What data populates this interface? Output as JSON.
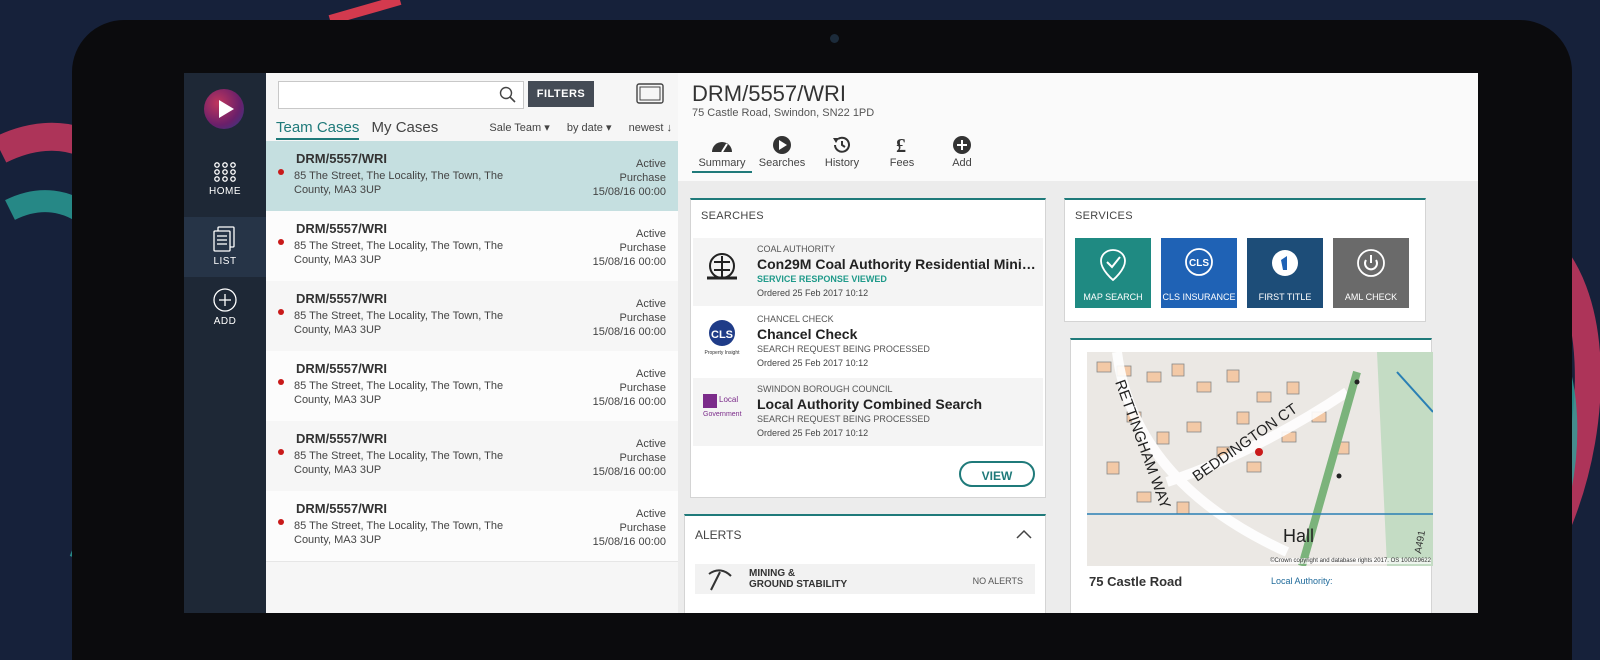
{
  "nav": {
    "items": [
      {
        "label": "HOME",
        "icon": "grid-icon"
      },
      {
        "label": "LIST",
        "icon": "document-list-icon"
      },
      {
        "label": "ADD",
        "icon": "plus-circle-icon"
      }
    ]
  },
  "list": {
    "search_placeholder": "",
    "filters_label": "FILTERS",
    "tabs": [
      "Team Cases",
      "My Cases"
    ],
    "sorts": [
      "Sale Team",
      "by date",
      "newest"
    ],
    "cases": [
      {
        "ref": "DRM/5557/WRI",
        "address": "85 The Street, The Locality, The Town, The County, MA3 3UP",
        "status": "Active",
        "type": "Purchase",
        "date": "15/08/16 00:00"
      },
      {
        "ref": "DRM/5557/WRI",
        "address": "85 The Street, The Locality, The Town, The County, MA3 3UP",
        "status": "Active",
        "type": "Purchase",
        "date": "15/08/16 00:00"
      },
      {
        "ref": "DRM/5557/WRI",
        "address": "85 The Street, The Locality, The Town, The County, MA3 3UP",
        "status": "Active",
        "type": "Purchase",
        "date": "15/08/16 00:00"
      },
      {
        "ref": "DRM/5557/WRI",
        "address": "85 The Street, The Locality, The Town, The County, MA3 3UP",
        "status": "Active",
        "type": "Purchase",
        "date": "15/08/16 00:00"
      },
      {
        "ref": "DRM/5557/WRI",
        "address": "85 The Street, The Locality, The Town, The County, MA3 3UP",
        "status": "Active",
        "type": "Purchase",
        "date": "15/08/16 00:00"
      },
      {
        "ref": "DRM/5557/WRI",
        "address": "85 The Street, The Locality, The Town, The County, MA3 3UP",
        "status": "Active",
        "type": "Purchase",
        "date": "15/08/16 00:00"
      }
    ]
  },
  "detail": {
    "title": "DRM/5557/WRI",
    "subtitle": "75 Castle Road, Swindon, SN22 1PD",
    "tabs": [
      {
        "label": "Summary",
        "icon": "gauge-icon"
      },
      {
        "label": "Searches",
        "icon": "play-circle-icon"
      },
      {
        "label": "History",
        "icon": "history-icon"
      },
      {
        "label": "Fees",
        "icon": "pound-icon"
      },
      {
        "label": "Add",
        "icon": "plus-circle-icon"
      }
    ],
    "searches": {
      "title": "SEARCHES",
      "rows": [
        {
          "org": "COAL AUTHORITY",
          "name": "Con29M Coal Authority Residential Mining...",
          "status": "SERVICE RESPONSE VIEWED",
          "ordered": "Ordered 25 Feb 2017 10:12",
          "logo_text": ""
        },
        {
          "org": "CHANCEL CHECK",
          "name": "Chancel Check",
          "status": "SEARCH REQUEST BEING PROCESSED",
          "ordered": "Ordered 25 Feb 2017 10:12",
          "logo_text": "CLS",
          "logo_sub": "Property Insight"
        },
        {
          "org": "SWINDON BOROUGH COUNCIL",
          "name": "Local Authority Combined Search",
          "status": "SEARCH REQUEST BEING PROCESSED",
          "ordered": "Ordered 25 Feb 2017 10:12",
          "logo_text": "Local",
          "logo_sub": "Government"
        }
      ],
      "view_label": "VIEW"
    },
    "services": {
      "title": "SERVICES",
      "items": [
        {
          "label": "MAP SEARCH",
          "color": "#1f8a82"
        },
        {
          "label": "CLS INSURANCE",
          "color": "#1f62b5"
        },
        {
          "label": "FIRST TITLE",
          "color": "#1d4d78"
        },
        {
          "label": "AML CHECK",
          "color": "#6a6a6a"
        }
      ]
    },
    "map": {
      "labels": [
        "RETTINGHAM WAY",
        "BEDDINGTON CT",
        "Hall",
        "A491"
      ],
      "copyright": "©Crown copyright and database rights 2017. OS 100029622",
      "address": "75 Castle Road",
      "local_authority": "Local Authority:"
    },
    "alerts": {
      "title": "ALERTS",
      "row_title": [
        "MINING &",
        "GROUND STABILITY"
      ],
      "row_value": "NO ALERTS"
    }
  }
}
